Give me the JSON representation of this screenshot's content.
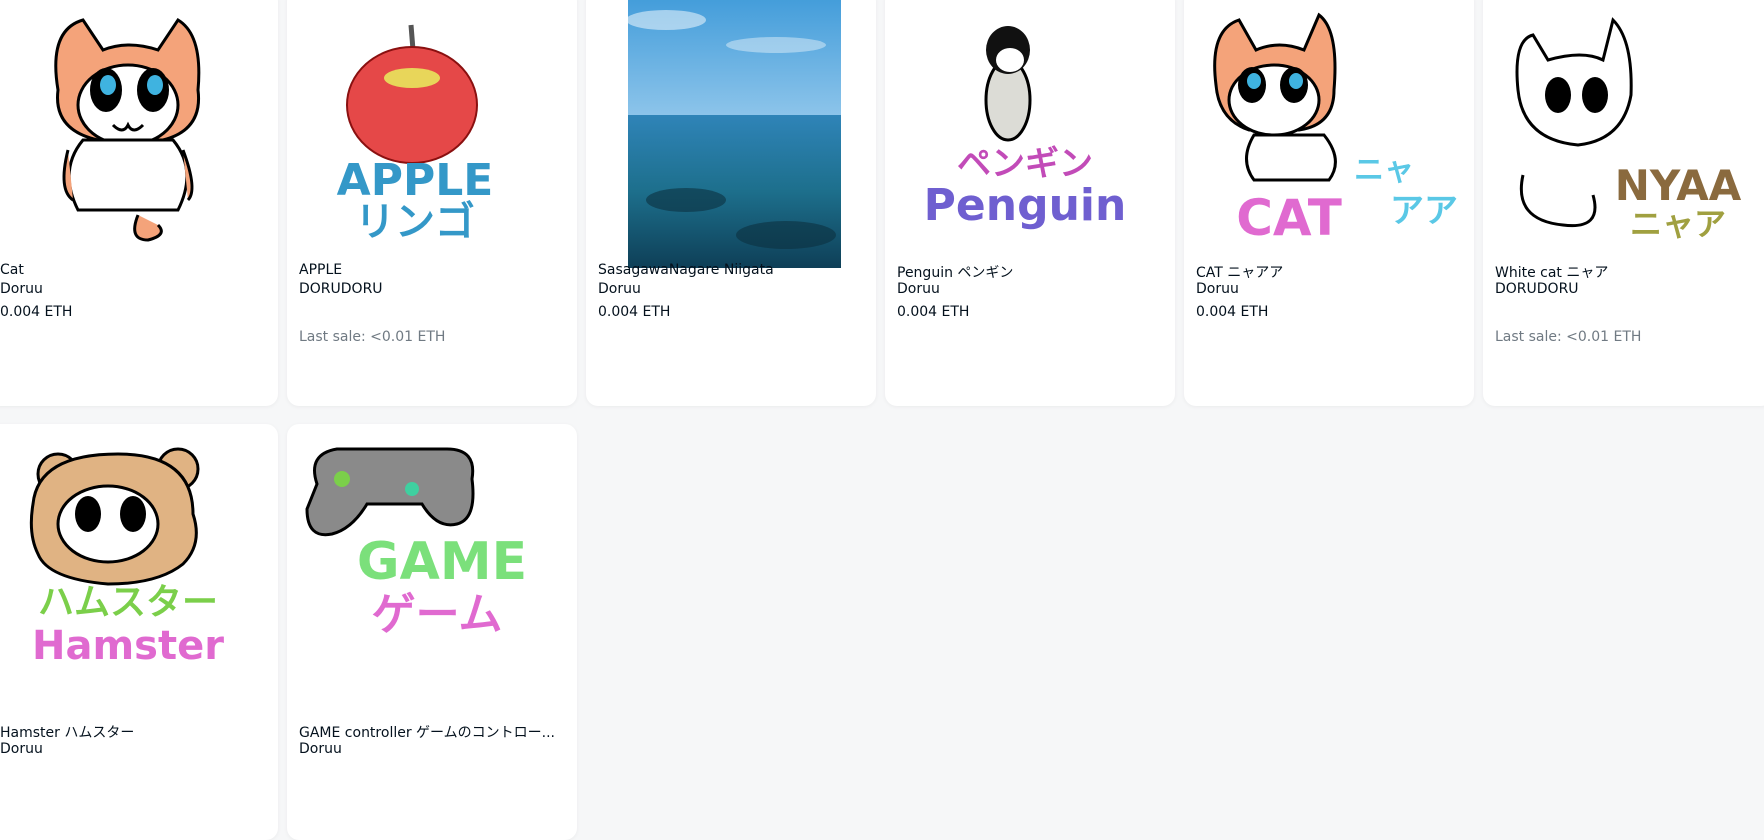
{
  "items": [
    {
      "name": "Cat",
      "creator": "Doruu",
      "price": "0.004 ETH",
      "art_text": ""
    },
    {
      "name": "APPLE",
      "creator": "DORUDORU",
      "last_sale": "Last sale: <0.01 ETH",
      "art_text_1": "APPLE",
      "art_text_2": "リンゴ"
    },
    {
      "name": "SasagawaNagare Niigata",
      "creator": "Doruu",
      "price": "0.004 ETH"
    },
    {
      "name": "Penguin ペンギン",
      "creator": "Doruu",
      "price": "0.004 ETH",
      "art_text_1": "ペンギン",
      "art_text_2": "Penguin"
    },
    {
      "name": "CAT ニャアア",
      "creator": "Doruu",
      "price": "0.004 ETH",
      "art_text_1": "ニャ",
      "art_text_2": "CAT",
      "art_text_3": "アア"
    },
    {
      "name": "White cat ニャア",
      "creator": "DORUDORU",
      "last_sale": "Last sale: <0.01 ETH",
      "art_text_1": "NYAA",
      "art_text_2": "ニャア"
    },
    {
      "name": "Hamster ハムスター",
      "creator": "Doruu",
      "art_text_1": "ハムスター",
      "art_text_2": "Hamster"
    },
    {
      "name": "GAME controller ゲームのコントロー...",
      "creator": "Doruu",
      "art_text_1": "GAME",
      "art_text_2": "ゲーム"
    }
  ],
  "colors": {
    "background": "#f6f7f8",
    "card": "#ffffff",
    "text": "#04111d",
    "muted": "#707a83"
  }
}
